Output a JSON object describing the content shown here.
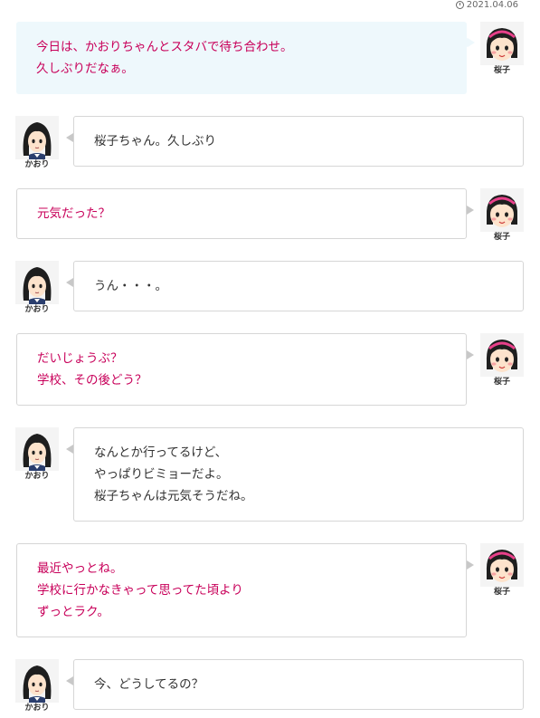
{
  "post": {
    "date": "2021.04.06"
  },
  "speakers": {
    "sakurako": "桜子",
    "kaori": "かおり"
  },
  "messages": [
    {
      "speaker": "sakurako",
      "lines": [
        "今日は、かおりちゃんとスタバで待ち合わせ。",
        "久しぶりだなぁ。"
      ]
    },
    {
      "speaker": "kaori",
      "lines": [
        "桜子ちゃん。久しぶり"
      ]
    },
    {
      "speaker": "sakurako",
      "lines": [
        "元気だった？"
      ]
    },
    {
      "speaker": "kaori",
      "lines": [
        "うん・・・。"
      ]
    },
    {
      "speaker": "sakurako",
      "lines": [
        "だいじょうぶ？",
        "学校、その後どう？"
      ]
    },
    {
      "speaker": "kaori",
      "lines": [
        "なんとか行ってるけど、",
        "やっぱりビミョーだよ。",
        "桜子ちゃんは元気そうだね。"
      ]
    },
    {
      "speaker": "sakurako",
      "lines": [
        "最近やっとね。",
        "学校に行かなきゃって思ってた頃より",
        "ずっとラク。"
      ]
    },
    {
      "speaker": "kaori",
      "lines": [
        "今、どうしてるの？"
      ]
    }
  ],
  "colors": {
    "sakurako_text": "#c8005a",
    "kaori_text": "#333333",
    "first_bubble_bg": "#eef8fc"
  },
  "icons": {
    "sakurako": "girl-pink-headband-icon",
    "kaori": "girl-long-black-hair-icon",
    "date": "clock-icon"
  }
}
